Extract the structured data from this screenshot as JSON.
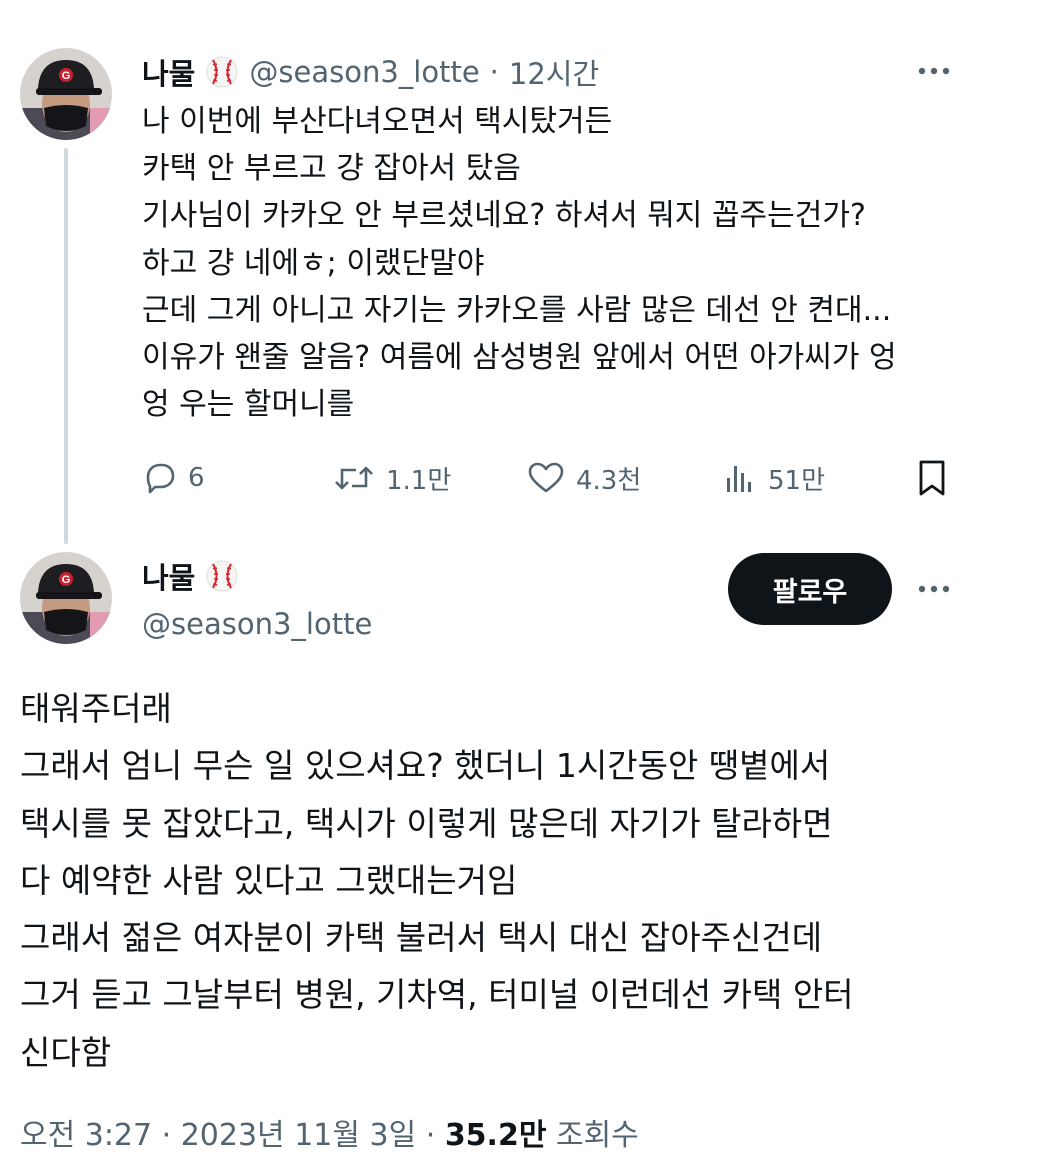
{
  "thread_tweet": {
    "author_name": "나물",
    "author_handle": "@season3_lotte",
    "separator": "·",
    "time_ago": "12시간",
    "badge_icon": "baseball-icon",
    "lines": [
      "나 이번에 부산다녀오면서 택시탔거든",
      "카택 안 부르고 걍 잡아서 탔음",
      "기사님이 카카오 안 부르셨네요? 하셔서 뭐지 꼽주는건가?",
      "하고 걍 네에ㅎ; 이랬단말야",
      "근데 그게 아니고 자기는 카카오를 사람 많은 데선 안 켠대...",
      "이유가 왠줄 알음? 여름에 삼성병원 앞에서 어떤 아가씨가 엉",
      "엉 우는 할머니를"
    ],
    "actions": {
      "replies": "6",
      "retweets": "1.1만",
      "likes": "4.3천",
      "views": "51만"
    }
  },
  "main_tweet": {
    "author_name": "나물",
    "author_handle": "@season3_lotte",
    "badge_icon": "baseball-icon",
    "follow_label": "팔로우",
    "lines": [
      "태워주더래",
      "그래서 엄니 무슨 일 있으셔요? 했더니 1시간동안 땡볕에서",
      "택시를 못 잡았다고, 택시가 이렇게 많은데 자기가 탈라하면",
      "다 예약한 사람 있다고 그랬대는거임",
      "그래서 젊은 여자분이 카택 불러서 택시 대신 잡아주신건데",
      "그거 듣고 그날부터 병원, 기차역, 터미널 이런데선 카택 안터",
      "신다함"
    ],
    "timestamp": "오전 3:27 · 2023년 11월 3일 · ",
    "views_count": "35.2만",
    "views_label": " 조회수"
  },
  "colors": {
    "text_primary": "#0f1419",
    "text_secondary": "#536471",
    "thread_line": "#cfd9de",
    "button_bg": "#0f1419",
    "baseball_stitch": "#d9232f"
  }
}
